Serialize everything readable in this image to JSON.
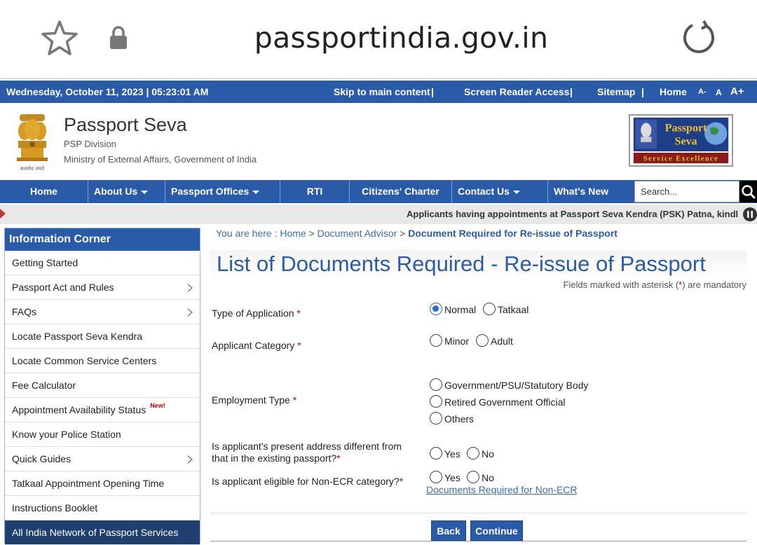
{
  "browser": {
    "url": "passportindia.gov.in",
    "star_icon": "star-outline-icon",
    "lock_icon": "lock-icon",
    "reload_icon": "reload-icon"
  },
  "topstrip": {
    "datetime": "Wednesday,  October  11, 2023 | 05:23:01 AM",
    "skip": "Skip to main content",
    "reader": "Screen Reader Access",
    "sitemap": "Sitemap",
    "home": "Home",
    "font_small": "A-",
    "font_normal": "A",
    "font_large": "A+",
    "sep": "|"
  },
  "header": {
    "title": "Passport Seva",
    "division": "PSP Division",
    "ministry": "Ministry of External Affairs, Government of India",
    "emblem_motto": "सत्यमेव जयते",
    "logo_line1": "Passport",
    "logo_line2": "Seva",
    "logo_tagline": "Service Excellence"
  },
  "nav": {
    "items": [
      "Home",
      "About Us",
      "Passport Offices",
      "RTI",
      "Citizens' Charter",
      "Contact Us",
      "What's New"
    ],
    "search_placeholder": "Search..."
  },
  "marquee": {
    "text": "Applicants having appointments at Passport Seva Kendra (PSK) Patna, kindly no"
  },
  "sidebar": {
    "title": "Information Corner",
    "items": [
      "Getting Started",
      "Passport Act and Rules",
      "FAQs",
      "Locate Passport Seva Kendra",
      "Locate Common Service Centers",
      "Fee Calculator",
      "Appointment Availability Status",
      "Know your Police Station",
      "Quick Guides",
      "Tatkaal Appointment Opening Time",
      "Instructions Booklet",
      "All India Network of Passport Services"
    ],
    "new_badge": "New!"
  },
  "main": {
    "breadcrumb_prefix": "You are here : ",
    "crumb_home": "Home",
    "crumb_advisor": "Document Advisor",
    "crumb_current": "Document Required for Re-issue of Passport",
    "crumb_sep": " > ",
    "title": "List of Documents Required - Re-issue of Passport",
    "mandatory_pre": "Fields marked with asterisk (",
    "mandatory_ast": "*",
    "mandatory_post": ") are mandatory",
    "q_type": "Type of Application",
    "q_category": "Applicant Category",
    "q_employment": "Employment Type",
    "q_address_line1": "Is applicant's present address different from",
    "q_address_line2": "that in the existing passport?",
    "q_ecr": "Is applicant eligible for Non-ECR category?",
    "ast": "*",
    "opt_normal": "Normal",
    "opt_tatkaal": "Tatkaal",
    "opt_minor": "Minor",
    "opt_adult": "Adult",
    "opt_govt": "Government/PSU/Statutory Body",
    "opt_retired": "Retired Government Official",
    "opt_others": "Others",
    "opt_yes": "Yes",
    "opt_no": "No",
    "noecr_link": "Documents Required for Non-ECR",
    "back": "Back",
    "continue": "Continue"
  }
}
